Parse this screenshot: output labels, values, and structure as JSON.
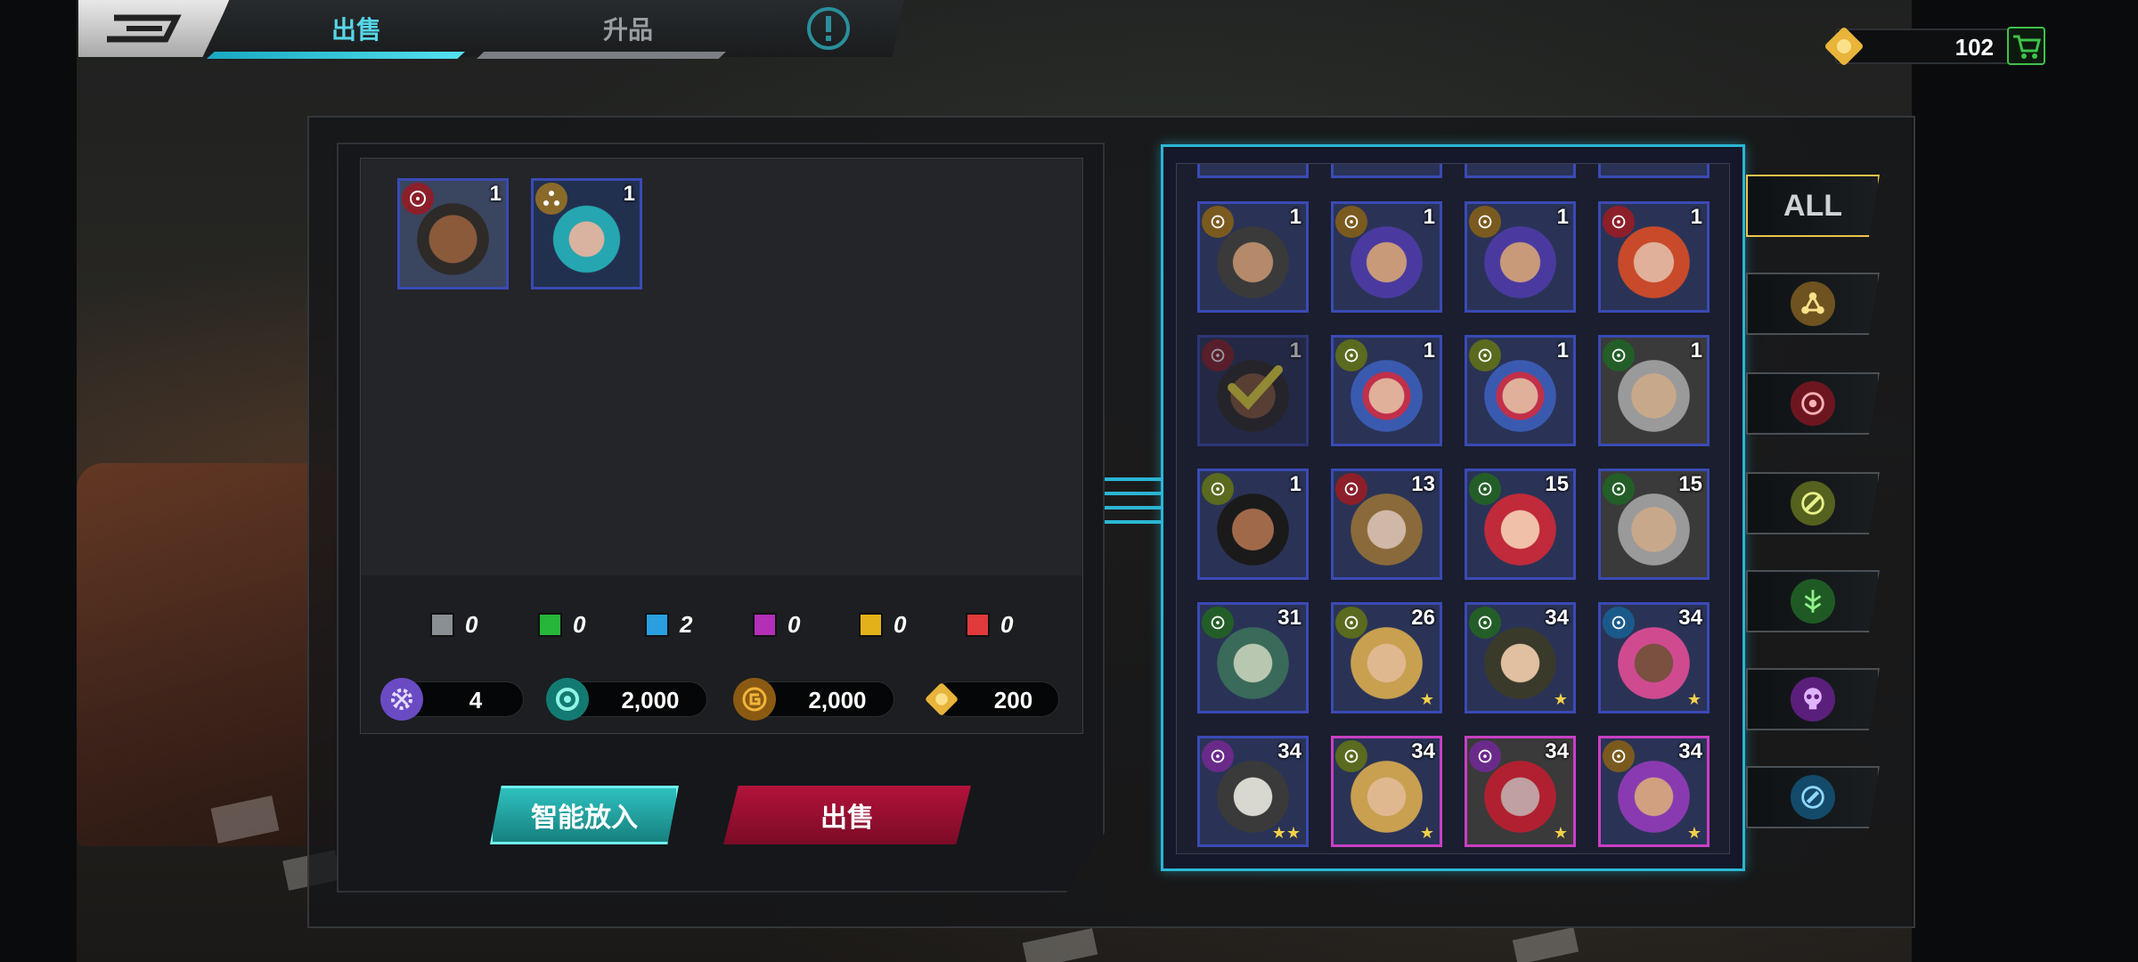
{
  "tabs": {
    "sell_label": "出售",
    "upgrade_label": "升品"
  },
  "currency": {
    "puzzle_value": "102"
  },
  "selected_cards": [
    {
      "level": "1",
      "class": "target"
    },
    {
      "level": "1",
      "class": "tech"
    }
  ],
  "rarity_counts": [
    {
      "color": "#8a8f94",
      "value": "0"
    },
    {
      "color": "#27b53a",
      "value": "0"
    },
    {
      "color": "#2a9fe0",
      "value": "2"
    },
    {
      "color": "#b22fb6",
      "value": "0"
    },
    {
      "color": "#e3b21a",
      "value": "0"
    },
    {
      "color": "#e03a3a",
      "value": "0"
    }
  ],
  "rewards": [
    {
      "icon": "purple-gear-icon",
      "value": "4"
    },
    {
      "icon": "teal-coin-icon",
      "value": "2,000"
    },
    {
      "icon": "gold-coin-icon",
      "value": "2,000"
    },
    {
      "icon": "puzzle-icon",
      "value": "200"
    }
  ],
  "buttons": {
    "smart_label": "智能放入",
    "sell_label": "出售"
  },
  "filters": {
    "all_label": "ALL",
    "items": [
      "tech-class-icon",
      "target-class-icon",
      "wrench-class-icon",
      "bio-class-icon",
      "skull-class-icon",
      "shield-class-icon"
    ]
  },
  "hero_grid": [
    {
      "level": "1",
      "class": "tech",
      "stars": ""
    },
    {
      "level": "1",
      "class": "tech",
      "stars": ""
    },
    {
      "level": "1",
      "class": "tech",
      "stars": ""
    },
    {
      "level": "1",
      "class": "target",
      "stars": ""
    },
    {
      "level": "1",
      "class": "target",
      "stars": "",
      "selected": true
    },
    {
      "level": "1",
      "class": "wrench",
      "stars": ""
    },
    {
      "level": "1",
      "class": "wrench",
      "stars": ""
    },
    {
      "level": "1",
      "class": "bio",
      "stars": ""
    },
    {
      "level": "1",
      "class": "wrench",
      "stars": ""
    },
    {
      "level": "13",
      "class": "target",
      "stars": ""
    },
    {
      "level": "15",
      "class": "bio",
      "stars": ""
    },
    {
      "level": "15",
      "class": "bio",
      "stars": ""
    },
    {
      "level": "31",
      "class": "bio",
      "stars": ""
    },
    {
      "level": "26",
      "class": "wrench",
      "stars": "★"
    },
    {
      "level": "34",
      "class": "bio",
      "stars": "★"
    },
    {
      "level": "34",
      "class": "shield",
      "stars": "★"
    },
    {
      "level": "34",
      "class": "skull",
      "stars": "★★"
    },
    {
      "level": "34",
      "class": "wrench",
      "stars": "★",
      "rarity": "purple"
    },
    {
      "level": "34",
      "class": "skull",
      "stars": "★",
      "rarity": "purple"
    },
    {
      "level": "34",
      "class": "tech",
      "stars": "★",
      "rarity": "purple"
    }
  ]
}
